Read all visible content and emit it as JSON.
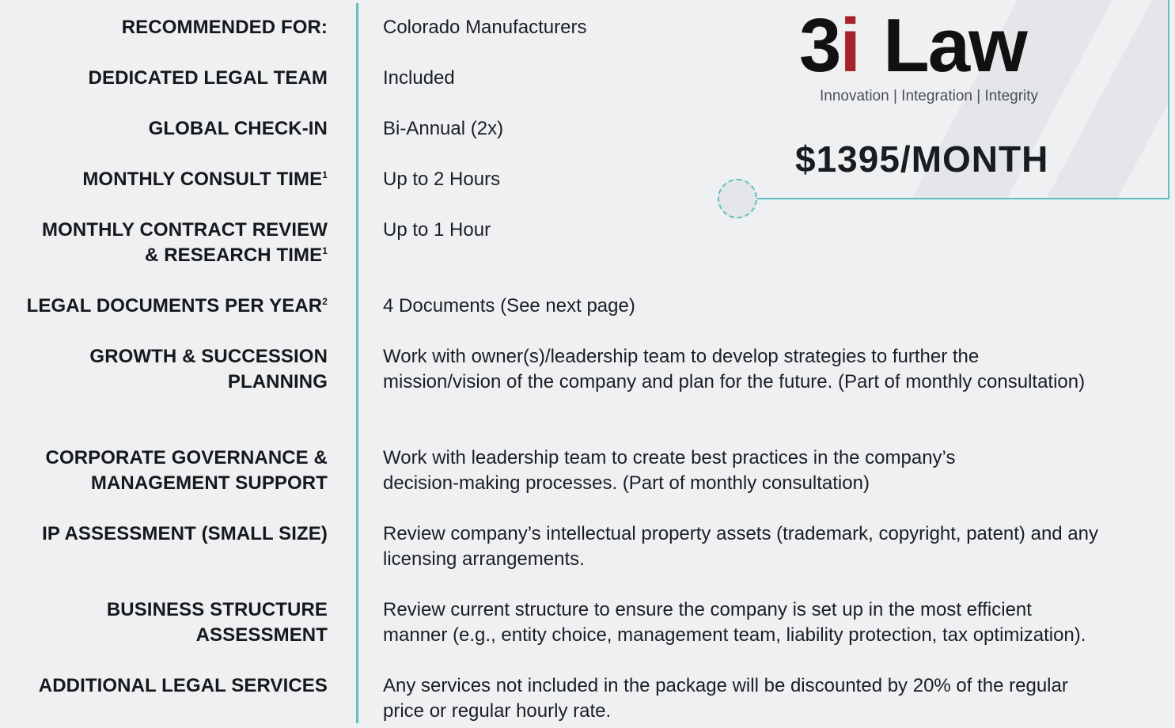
{
  "rows": [
    {
      "label": "RECOMMENDED FOR:",
      "sup": "",
      "value": "Colorado Manufacturers"
    },
    {
      "label": "DEDICATED LEGAL TEAM",
      "sup": "",
      "value": "Included"
    },
    {
      "label": "GLOBAL CHECK-IN",
      "sup": "",
      "value": "Bi-Annual (2x)"
    },
    {
      "label": "MONTHLY CONSULT TIME",
      "sup": "1",
      "value": "Up to 2 Hours"
    },
    {
      "label_line1": "MONTHLY CONTRACT REVIEW",
      "label_line2": "& RESEARCH TIME",
      "sup": "1",
      "value": "Up to 1 Hour"
    },
    {
      "label": "LEGAL DOCUMENTS PER YEAR",
      "sup": "2",
      "value": "4 Documents (See next page)"
    },
    {
      "label_line1": "GROWTH & SUCCESSION",
      "label_line2": "PLANNING",
      "value_line1": "Work with owner(s)/leadership team to develop strategies to further the",
      "value_line2": "mission/vision of the company and plan for the future. (Part of monthly consultation)"
    },
    {
      "label_line1": "CORPORATE GOVERNANCE &",
      "label_line2": "MANAGEMENT SUPPORT",
      "value_line1": "Work with leadership team to create best practices in the company’s",
      "value_line2": "decision-making processes. (Part of monthly consultation)"
    },
    {
      "label": "IP ASSESSMENT (SMALL SIZE)",
      "value_line1": "Review company’s intellectual property assets (trademark, copyright, patent) and any",
      "value_line2": "licensing arrangements."
    },
    {
      "label_line1": "BUSINESS STRUCTURE",
      "label_line2": "ASSESSMENT",
      "value_line1": "Review current structure to ensure the company is set up in the most efficient",
      "value_line2": "manner (e.g., entity choice, management team, liability protection, tax optimization)."
    },
    {
      "label": "ADDITIONAL LEGAL SERVICES",
      "value_line1": "Any services not included in the package will be discounted by 20% of the regular",
      "value_line2": "price or regular hourly rate."
    }
  ],
  "logo": {
    "part1": "3",
    "part2": "i",
    "part3": "Law",
    "tagline": "Innovation | Integration | Integrity"
  },
  "price": "$1395/MONTH",
  "colors": {
    "accent": "#5fbfc1",
    "brand_red": "#a8222a",
    "background": "#eff0f2"
  }
}
